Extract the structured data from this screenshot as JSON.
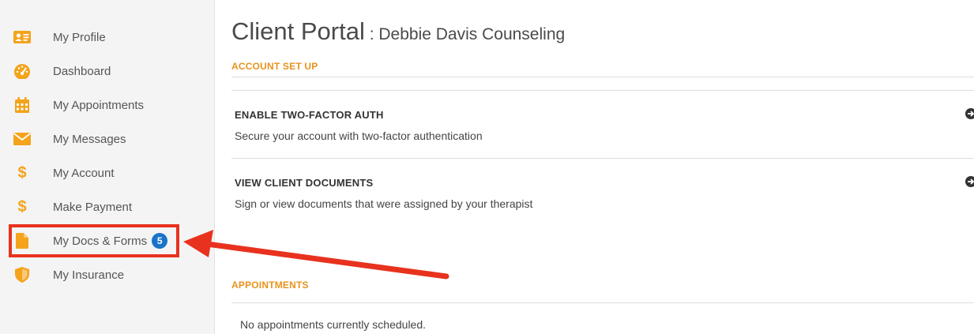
{
  "sidebar": {
    "items": [
      {
        "label": "My Profile",
        "icon": "profile-card-icon"
      },
      {
        "label": "Dashboard",
        "icon": "dashboard-gauge-icon"
      },
      {
        "label": "My Appointments",
        "icon": "calendar-icon"
      },
      {
        "label": "My Messages",
        "icon": "envelope-icon"
      },
      {
        "label": "My Account",
        "icon": "dollar-icon"
      },
      {
        "label": "Make Payment",
        "icon": "dollar-icon"
      },
      {
        "label": "My Docs & Forms",
        "icon": "document-icon",
        "badge": "5"
      },
      {
        "label": "My Insurance",
        "icon": "shield-icon"
      }
    ]
  },
  "header": {
    "title": "Client Portal",
    "separator": " : ",
    "subtitle": "Debbie Davis Counseling"
  },
  "sections": {
    "account_setup": {
      "header": "ACCOUNT SET UP",
      "cards": [
        {
          "title": "ENABLE TWO-FACTOR AUTH",
          "description": "Secure your account with two-factor authentication"
        },
        {
          "title": "VIEW CLIENT DOCUMENTS",
          "description": "Sign or view documents that were assigned by your therapist"
        }
      ]
    },
    "appointments": {
      "header": "APPOINTMENTS",
      "empty_text": "No appointments currently scheduled."
    }
  },
  "colors": {
    "accent_orange": "#e8931e",
    "badge_blue": "#1a73c9",
    "annotation_red": "#e8321e",
    "sidebar_bg": "#f4f4f4"
  }
}
